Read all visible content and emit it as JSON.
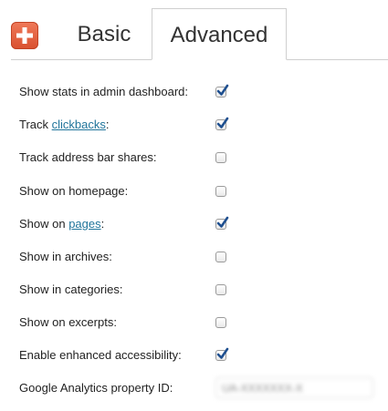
{
  "logo": {
    "icon": "plus-icon",
    "color": "#e35f3e"
  },
  "tabs": [
    {
      "label": "Basic",
      "active": false
    },
    {
      "label": "Advanced",
      "active": true
    }
  ],
  "settings": {
    "rows": [
      {
        "label": "Show stats in admin dashboard:",
        "checked": true
      },
      {
        "label_before": "Track ",
        "link": "clickbacks",
        "label_after": ":",
        "checked": true
      },
      {
        "label": "Track address bar shares:",
        "checked": false
      },
      {
        "label": "Show on homepage:",
        "checked": false
      },
      {
        "label_before": "Show on ",
        "link": "pages",
        "label_after": ":",
        "checked": true
      },
      {
        "label": "Show in archives:",
        "checked": false
      },
      {
        "label": "Show in categories:",
        "checked": false
      },
      {
        "label": "Show on excerpts:",
        "checked": false
      },
      {
        "label": "Enable enhanced accessibility:",
        "checked": true
      }
    ],
    "ga": {
      "label": "Google Analytics property ID:",
      "value": "UA-XXXXXXX-X"
    }
  },
  "colors": {
    "link": "#21759b",
    "check": "#1e4f8f",
    "tab_border": "#cfcfcf"
  }
}
